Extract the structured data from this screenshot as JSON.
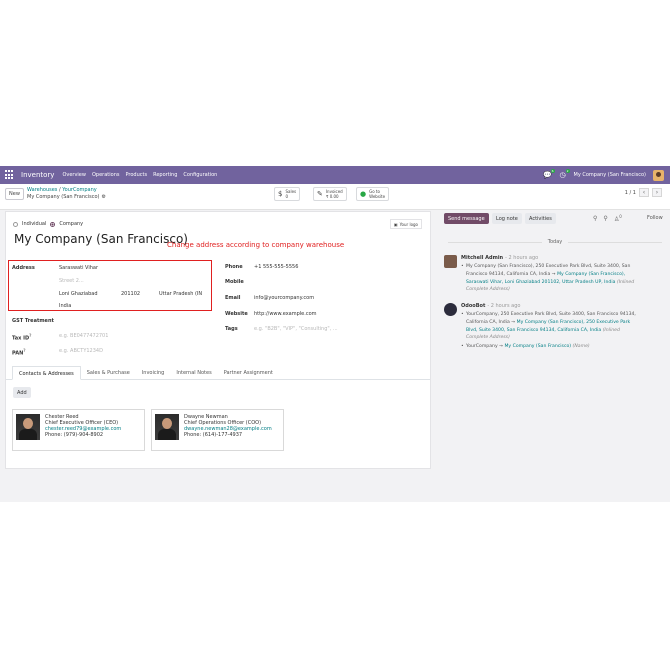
{
  "navbar": {
    "brand": "Inventory",
    "menu": [
      "Overview",
      "Operations",
      "Products",
      "Reporting",
      "Configuration"
    ],
    "chat_badge": "6",
    "activity_badge": "2",
    "company": "My Company (San Francisco)"
  },
  "control": {
    "new_label": "New",
    "breadcrumb_parent": "Warehouses",
    "breadcrumb_sep": "/",
    "breadcrumb_current": "YourCompany",
    "record_title": "My Company (San Francisco)",
    "smart_buttons": [
      {
        "line1": "Sales",
        "line2": "0",
        "icon": "dollar-icon"
      },
      {
        "line1": "Invoiced",
        "line2": "₹ 0.00",
        "icon": "invoice-icon"
      },
      {
        "line1": "Go to",
        "line2": "Website",
        "icon": "globe-icon"
      }
    ],
    "pager": "1 / 1"
  },
  "form": {
    "individual_label": "Individual",
    "company_label": "Company",
    "selected_type": "Company",
    "title": "My Company (San Francisco)",
    "logo_label": "Your logo",
    "annotation": "Change address according to company warehouse",
    "address_label": "Address",
    "street": "Saraswati Vihar",
    "street2_placeholder": "Street 2...",
    "city": "Loni Ghaziabad",
    "zip": "201102",
    "state": "Uttar Pradesh (IN",
    "country": "India",
    "gst_label": "GST Treatment",
    "taxid_label": "Tax ID",
    "taxid_placeholder": "e.g. BE0477472701",
    "pan_label": "PAN",
    "pan_placeholder": "e.g. ABCTY1234D",
    "phone_label": "Phone",
    "phone": "+1 555-555-5556",
    "mobile_label": "Mobile",
    "email_label": "Email",
    "email": "info@yourcompany.com",
    "website_label": "Website",
    "website": "http://www.example.com",
    "tags_label": "Tags",
    "tags_placeholder": "e.g. \"B2B\", \"VIP\", \"Consulting\", ..."
  },
  "tabs": [
    "Contacts & Addresses",
    "Sales & Purchase",
    "Invoicing",
    "Internal Notes",
    "Partner Assignment"
  ],
  "add_label": "Add",
  "contacts": [
    {
      "name": "Chester Reed",
      "title": "Chief Executive Officer (CEO)",
      "email": "chester.reed79@example.com",
      "phone": "Phone: (979)-904-8902"
    },
    {
      "name": "Dwayne Newman",
      "title": "Chief Operations Officer (COO)",
      "email": "dwayne.newman28@example.com",
      "phone": "Phone: (614)-177-4937"
    }
  ],
  "chatter": {
    "send_message": "Send message",
    "log_note": "Log note",
    "activities": "Activities",
    "follower_count": "0",
    "follow": "Follow",
    "today": "Today",
    "messages": [
      {
        "author": "Mitchell Admin",
        "time": "- 2 hours ago",
        "bullets": [
          {
            "old": "My Company (San Francisco), 250 Executive Park Blvd, Suite 3400, San Francisco 94134, California CA, India",
            "arrow": "→",
            "new": "My Company (San Francisco), Saraswati Vihar, Loni Ghaziabad 201102, Uttar Pradesh UP, India",
            "field": "(Inlined Complete Address)"
          }
        ]
      },
      {
        "author": "OdooBot",
        "time": "- 2 hours ago",
        "bullets": [
          {
            "old": "YourCompany, 250 Executive Park Blvd, Suite 3400, San Francisco 94134, California CA, India",
            "arrow": "→",
            "new": "My Company (San Francisco), 250 Executive Park Blvd, Suite 3400, San Francisco 94134, California CA, India",
            "field": "(Inlined Complete Address)"
          },
          {
            "old": "YourCompany",
            "arrow": "→",
            "new": "My Company (San Francisco)",
            "field": "(Name)"
          }
        ]
      }
    ]
  },
  "colors": {
    "navbar": "#71639e",
    "primary": "#714b67",
    "link": "#017e84",
    "annotation": "#e02020"
  }
}
